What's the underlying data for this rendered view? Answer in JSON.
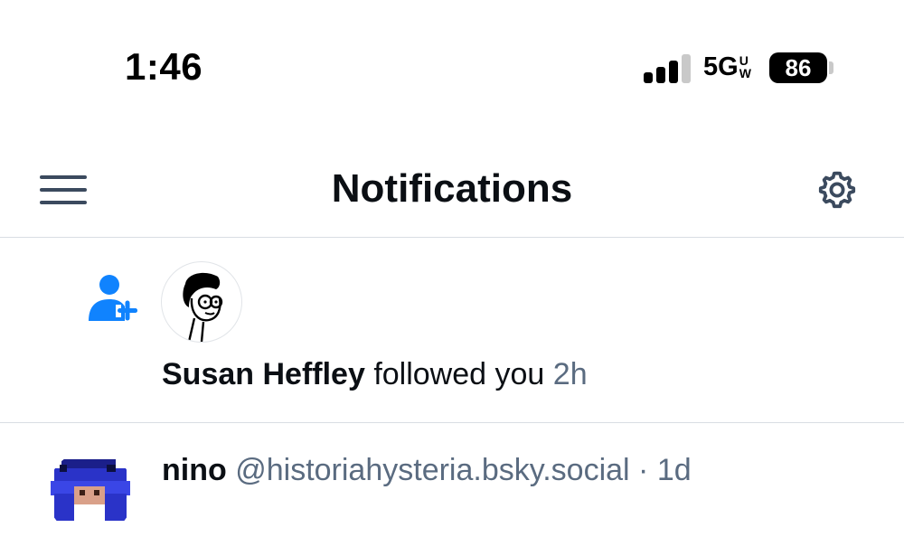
{
  "status_bar": {
    "time": "1:46",
    "network": "5G",
    "network_sup_1": "U",
    "network_sup_2": "W",
    "battery": "86"
  },
  "header": {
    "title": "Notifications",
    "menu_icon": "hamburger-menu-icon",
    "settings_icon": "gear-icon"
  },
  "notifications": [
    {
      "type": "follow",
      "icon": "person-add-icon",
      "name": "Susan Heffley",
      "action": "followed you",
      "time": "2h"
    },
    {
      "type": "post",
      "name": "nino",
      "handle": "@historiahysteria.bsky.social",
      "separator": "·",
      "time": "1d"
    }
  ],
  "colors": {
    "accent": "#1083fe",
    "muted_text": "#5a6b80",
    "icon": "#3b4a5e",
    "divider": "#d9dde3"
  }
}
